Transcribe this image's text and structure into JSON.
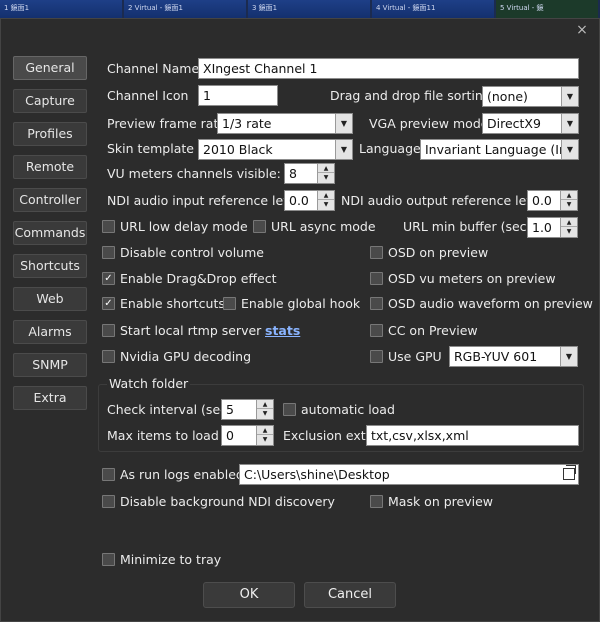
{
  "thumbnails": [
    "1 鏡面1",
    "2 Virtual - 鏡面1",
    "3 鏡面1",
    "4 Virtual - 鏡面11",
    "5 Virtual - 鏡"
  ],
  "nav": {
    "items": [
      "General",
      "Capture",
      "Profiles",
      "Remote",
      "Controller",
      "Commands",
      "Shortcuts",
      "Web",
      "Alarms",
      "SNMP",
      "Extra"
    ],
    "active": "General"
  },
  "fields": {
    "channel_name_label": "Channel Name",
    "channel_name_value": "XIngest Channel 1",
    "channel_icon_label": "Channel Icon",
    "channel_icon_value": "1",
    "dragdrop_sort_label": "Drag and drop file sorting",
    "dragdrop_sort_value": "(none)",
    "preview_rate_label": "Preview frame rate",
    "preview_rate_value": "1/3 rate",
    "vga_mode_label": "VGA preview mode",
    "vga_mode_value": "DirectX9",
    "skin_label": "Skin template",
    "skin_value": "2010 Black",
    "language_label": "Language",
    "language_value": "Invariant Language (Inva",
    "vu_label": "VU meters channels visible:",
    "vu_value": "8",
    "ndi_in_label": "NDI audio input reference level",
    "ndi_in_value": "0.0",
    "ndi_out_label": "NDI audio output reference level",
    "ndi_out_value": "0.0",
    "url_min_buffer_label": "URL min buffer (sec)",
    "url_min_buffer_value": "1.0",
    "gpu_mode_value": "RGB-YUV 601"
  },
  "checkboxes": {
    "url_low_delay": {
      "label": "URL low delay mode",
      "checked": false
    },
    "url_async": {
      "label": "URL async mode",
      "checked": false
    },
    "disable_control_volume": {
      "label": "Disable control volume",
      "checked": false
    },
    "osd_on_preview": {
      "label": "OSD on preview",
      "checked": false
    },
    "enable_dragdrop": {
      "label": "Enable Drag&Drop effect",
      "checked": true
    },
    "osd_vu_meters": {
      "label": "OSD vu meters on preview",
      "checked": false
    },
    "enable_shortcuts": {
      "label": "Enable shortcuts",
      "checked": true
    },
    "enable_global_hook": {
      "label": "Enable global hook",
      "checked": false
    },
    "osd_audio_waveform": {
      "label": "OSD audio waveform on preview",
      "checked": false
    },
    "start_rtmp": {
      "label": "Start local rtmp server",
      "checked": false
    },
    "cc_on_preview": {
      "label": "CC on Preview",
      "checked": false
    },
    "nvidia_decoding": {
      "label": "Nvidia GPU decoding",
      "checked": false
    },
    "use_gpu": {
      "label": "Use GPU",
      "checked": false
    },
    "automatic_load": {
      "label": "automatic load",
      "checked": false
    },
    "as_run_logs": {
      "label": "As run logs enabled",
      "checked": false
    },
    "disable_ndi_discovery": {
      "label": "Disable background NDI discovery",
      "checked": false
    },
    "mask_on_preview": {
      "label": "Mask on preview",
      "checked": false
    },
    "minimize_to_tray": {
      "label": "Minimize to tray",
      "checked": false
    }
  },
  "stats_link": "stats",
  "watch_folder": {
    "title": "Watch folder",
    "check_interval_label": "Check interval (sec)",
    "check_interval_value": "5",
    "max_items_label": "Max items to load",
    "max_items_value": "0",
    "exclusion_label": "Exclusion ext.",
    "exclusion_value": "txt,csv,xlsx,xml"
  },
  "as_run_path": "C:\\Users\\shine\\Desktop",
  "footer": {
    "ok_label": "OK",
    "cancel_label": "Cancel"
  },
  "glyphs": {
    "close": "×",
    "check": "✓",
    "arrow_down": "▼",
    "arrow_up": "▲"
  }
}
